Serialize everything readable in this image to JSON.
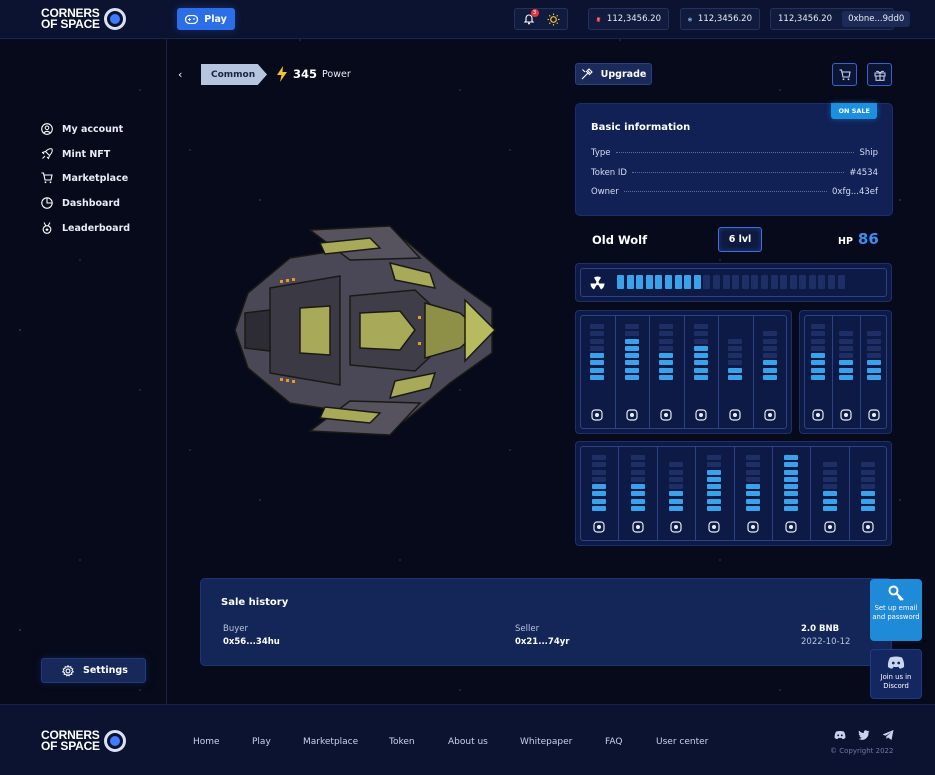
{
  "header": {
    "logo_text": "CORNERS\nOF SPACE",
    "play_label": "Play",
    "notification_count": "3",
    "balance_1": "112,3456.20",
    "balance_2": "112,3456.20",
    "balance_3": "112,3456.20",
    "wallet_address": "0xbne...9dd0"
  },
  "sidebar": {
    "items": [
      {
        "label": "My account",
        "icon": "user-circle-icon"
      },
      {
        "label": "Mint NFT",
        "icon": "rocket-icon"
      },
      {
        "label": "Marketplace",
        "icon": "cart-icon"
      },
      {
        "label": "Dashboard",
        "icon": "pie-chart-icon"
      },
      {
        "label": "Leaderboard",
        "icon": "medal-icon"
      }
    ],
    "settings_label": "Settings"
  },
  "item": {
    "rarity": "Common",
    "power_value": "345",
    "power_label": "Power",
    "upgrade_label": "Upgrade",
    "on_sale_label": "ON SALE",
    "info_title": "Basic information",
    "info_rows": [
      {
        "label": "Type",
        "value": "Ship"
      },
      {
        "label": "Token ID",
        "value": "#4534"
      },
      {
        "label": "Owner",
        "value": "0xfg...43ef"
      }
    ],
    "name": "Old Wolf",
    "level": "6 lvl",
    "hp_label": "HP",
    "hp_value": "86",
    "radiation_level": 9,
    "radiation_total": 24
  },
  "stats_group_1": [
    4,
    6,
    4,
    5,
    2,
    3
  ],
  "stats_group_2": [
    4,
    3,
    3
  ],
  "stats_group_3": [
    4,
    4,
    3,
    6,
    4,
    8,
    3,
    3
  ],
  "sale_history": {
    "title": "Sale history",
    "buyer_label": "Buyer",
    "buyer_value": "0x56...34hu",
    "seller_label": "Seller",
    "seller_value": "0x21...74yr",
    "price": "2.0 BNB",
    "date": "2022-10-12"
  },
  "widgets": {
    "setup_label": "Set up email and password",
    "discord_label": "Join us in Discord"
  },
  "footer": {
    "links": [
      "Home",
      "Play",
      "Marketplace",
      "Token",
      "About us",
      "Whitepaper",
      "FAQ",
      "User center"
    ],
    "copyright": "© Copyright 2022"
  },
  "colors": {
    "accent": "#2c6ee8",
    "bar_on": "#3aa2ea",
    "hp": "#3c8df0"
  }
}
